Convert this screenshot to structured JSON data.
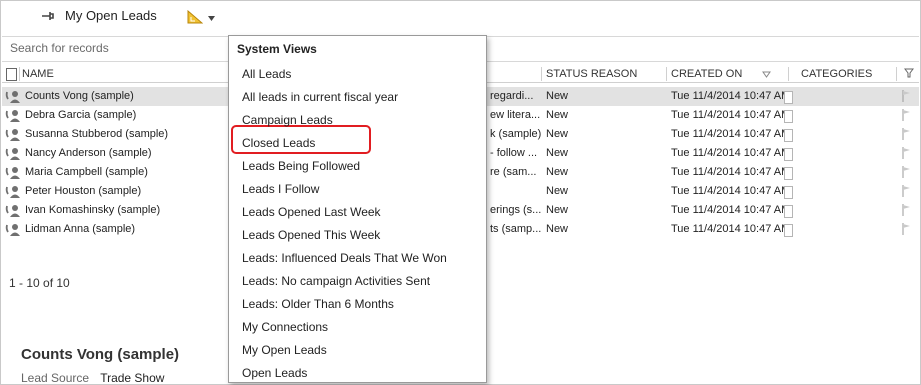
{
  "header": {
    "title": "My Open Leads",
    "pin_icon": "pin-icon",
    "view_picker_icon": "view-picker-icon"
  },
  "search": {
    "placeholder": "Search for records",
    "value": ""
  },
  "columns": {
    "name": "NAME",
    "status_reason": "STATUS REASON",
    "created_on": "CREATED ON",
    "categories": "CATEGORIES"
  },
  "rows": [
    {
      "name": "Counts Vong (sample)",
      "topic": "regardi...",
      "status": "New",
      "created_on": "Tue 11/4/2014 10:47 AM"
    },
    {
      "name": "Debra Garcia (sample)",
      "topic": "ew litera...",
      "status": "New",
      "created_on": "Tue 11/4/2014 10:47 AM"
    },
    {
      "name": "Susanna Stubberod (sample)",
      "topic": "k (sample)",
      "status": "New",
      "created_on": "Tue 11/4/2014 10:47 AM"
    },
    {
      "name": "Nancy Anderson (sample)",
      "topic": "- follow ...",
      "status": "New",
      "created_on": "Tue 11/4/2014 10:47 AM"
    },
    {
      "name": "Maria Campbell (sample)",
      "topic": "re (sam...",
      "status": "New",
      "created_on": "Tue 11/4/2014 10:47 AM"
    },
    {
      "name": "Peter Houston (sample)",
      "topic": "",
      "status": "New",
      "created_on": "Tue 11/4/2014 10:47 AM"
    },
    {
      "name": "Ivan Komashinsky (sample)",
      "topic": "erings (s...",
      "status": "New",
      "created_on": "Tue 11/4/2014 10:47 AM"
    },
    {
      "name": "Lidman Anna (sample)",
      "topic": "ts (samp...",
      "status": "New",
      "created_on": "Tue 11/4/2014 10:47 AM"
    }
  ],
  "pager": {
    "text": "1 - 10 of 10"
  },
  "detail": {
    "name": "Counts Vong (sample)",
    "field_label": "Lead Source",
    "field_value": "Trade Show"
  },
  "dropdown": {
    "heading": "System Views",
    "highlighted": "Closed Leads",
    "items": [
      "All Leads",
      "All leads in current fiscal year",
      "Campaign Leads",
      "Closed Leads",
      "Leads Being Followed",
      "Leads I Follow",
      "Leads Opened Last Week",
      "Leads Opened This Week",
      "Leads: Influenced Deals That We Won",
      "Leads: No campaign Activities Sent",
      "Leads: Older Than 6 Months",
      "My Connections",
      "My Open Leads",
      "Open Leads"
    ]
  },
  "colors": {
    "highlight_border": "#e11d21",
    "selected_row": "#e2e2e2",
    "lead_icon": "#707070"
  }
}
